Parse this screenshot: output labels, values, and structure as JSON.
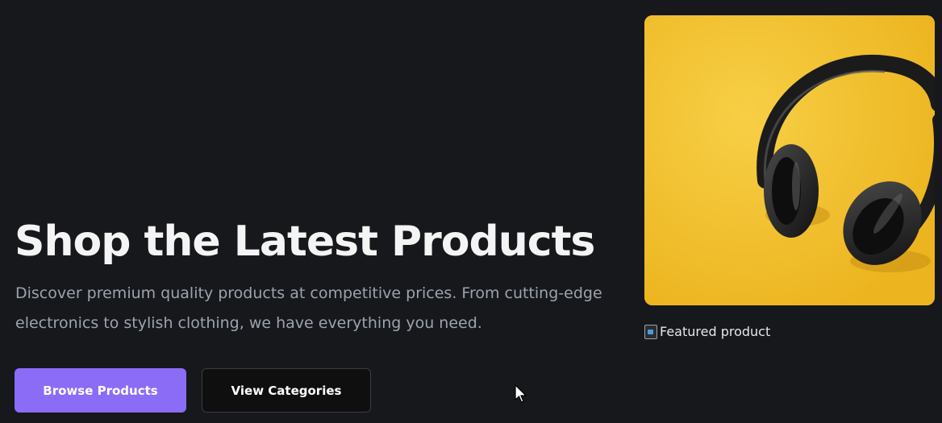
{
  "hero": {
    "title": "Shop the Latest Products",
    "subtitle": "Discover premium quality products at competitive prices. From cutting-edge electronics to stylish clothing, we have everything you need."
  },
  "actions": {
    "primary_label": "Browse Products",
    "secondary_label": "View Categories"
  },
  "featured": {
    "image_description": "black over-ear headphones on a yellow background",
    "alt_text": "Featured product"
  },
  "colors": {
    "background": "#16181b",
    "accent": "#8b6cf6",
    "image_background": "#f3c130"
  },
  "icons": {
    "broken_image": "broken-image-icon",
    "cursor": "mouse-cursor-icon"
  }
}
